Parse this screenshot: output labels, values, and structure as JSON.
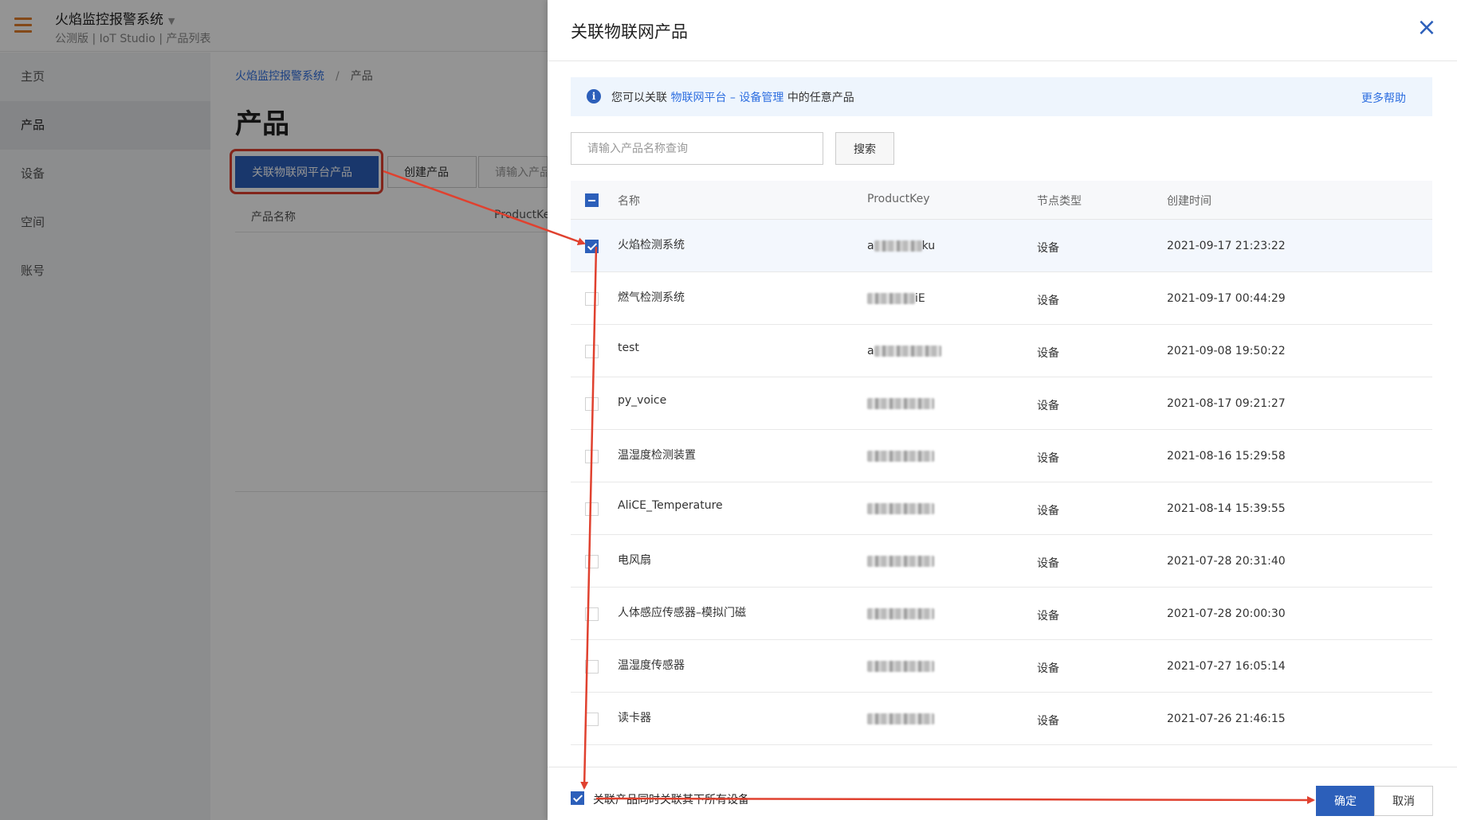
{
  "app": {
    "title": "火焰监控报警系统",
    "subtitle": "公测版 | IoT Studio | 产品列表"
  },
  "sidebar": {
    "items": [
      {
        "label": "主页"
      },
      {
        "label": "产品"
      },
      {
        "label": "设备"
      },
      {
        "label": "空间"
      },
      {
        "label": "账号"
      }
    ]
  },
  "breadcrumb": {
    "root": "火焰监控报警系统",
    "separator": "/",
    "current": "产品"
  },
  "page": {
    "title": "产品",
    "link_button": "关联物联网平台产品",
    "create_button": "创建产品",
    "search_placeholder": "请输入产品名称查询",
    "col_name": "产品名称",
    "col_key": "ProductKey"
  },
  "drawer": {
    "title": "关联物联网产品",
    "info_prefix": "您可以关联",
    "info_link": "物联网平台 – 设备管理",
    "info_suffix": "中的任意产品",
    "help_link": "更多帮助",
    "search_placeholder": "请输入产品名称查询",
    "search_button": "搜索",
    "columns": {
      "name": "名称",
      "key": "ProductKey",
      "type": "节点类型",
      "time": "创建时间"
    },
    "rows": [
      {
        "name": "火焰检测系统",
        "key_prefix": "a",
        "key_suffix": "ku",
        "type": "设备",
        "time": "2021-09-17 21:23:22",
        "checked": true
      },
      {
        "name": "燃气检测系统",
        "key_prefix": "",
        "key_suffix": "iE",
        "type": "设备",
        "time": "2021-09-17 00:44:29",
        "checked": false
      },
      {
        "name": "test",
        "key_prefix": "a",
        "key_suffix": "",
        "type": "设备",
        "time": "2021-09-08 19:50:22",
        "checked": false
      },
      {
        "name": "py_voice",
        "key_prefix": "",
        "key_suffix": "",
        "type": "设备",
        "time": "2021-08-17 09:21:27",
        "checked": false
      },
      {
        "name": "温湿度检测装置",
        "key_prefix": "",
        "key_suffix": "",
        "type": "设备",
        "time": "2021-08-16 15:29:58",
        "checked": false
      },
      {
        "name": "AliCE_Temperature",
        "key_prefix": "",
        "key_suffix": "",
        "type": "设备",
        "time": "2021-08-14 15:39:55",
        "checked": false
      },
      {
        "name": "电风扇",
        "key_prefix": "",
        "key_suffix": "",
        "type": "设备",
        "time": "2021-07-28 20:31:40",
        "checked": false
      },
      {
        "name": "人体感应传感器–模拟门磁",
        "key_prefix": "",
        "key_suffix": "",
        "type": "设备",
        "time": "2021-07-28 20:00:30",
        "checked": false
      },
      {
        "name": "温湿度传感器",
        "key_prefix": "",
        "key_suffix": "",
        "type": "设备",
        "time": "2021-07-27 16:05:14",
        "checked": false
      },
      {
        "name": "读卡器",
        "key_prefix": "",
        "key_suffix": "",
        "type": "设备",
        "time": "2021-07-26 21:46:15",
        "checked": false
      }
    ],
    "footer_checkbox_label": "关联产品同时关联其下所有设备",
    "footer_checked": true,
    "confirm_button": "确定",
    "cancel_button": "取消"
  },
  "colors": {
    "primary": "#2c5fba",
    "link": "#2f6fe0",
    "annotation_red": "#e0412f",
    "hamburger": "#e27f2c"
  },
  "icons": {
    "menu": "hamburger-icon",
    "info": "info-icon",
    "close": "close-icon",
    "caret": "caret-down-icon"
  }
}
